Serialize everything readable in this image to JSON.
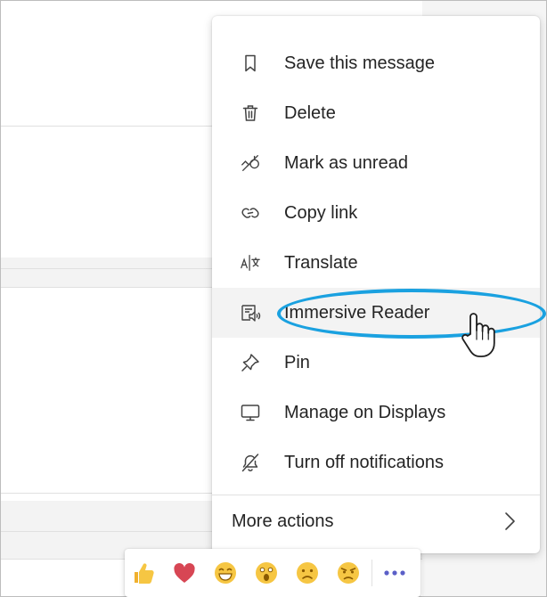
{
  "menu": {
    "items": [
      {
        "label": "Save this message",
        "icon": "bookmark-icon"
      },
      {
        "label": "Delete",
        "icon": "trash-icon"
      },
      {
        "label": "Mark as unread",
        "icon": "mark-unread-icon"
      },
      {
        "label": "Copy link",
        "icon": "link-icon"
      },
      {
        "label": "Translate",
        "icon": "translate-icon"
      },
      {
        "label": "Immersive Reader",
        "icon": "immersive-reader-icon",
        "hovered": true
      },
      {
        "label": "Pin",
        "icon": "pin-icon"
      },
      {
        "label": "Manage on Displays",
        "icon": "display-icon"
      },
      {
        "label": "Turn off notifications",
        "icon": "bell-off-icon"
      }
    ],
    "more_actions": {
      "label": "More actions",
      "icon": "chevron-right-icon"
    }
  },
  "reactions": {
    "items": [
      "like",
      "heart",
      "laugh",
      "surprised",
      "sad",
      "angry"
    ],
    "more_icon": "more-icon"
  },
  "colors": {
    "highlight": "#1aa1e0",
    "heart": "#d74654",
    "emoji": "#f6c643",
    "more_dots": "#5b5fc7",
    "text": "#242424"
  }
}
